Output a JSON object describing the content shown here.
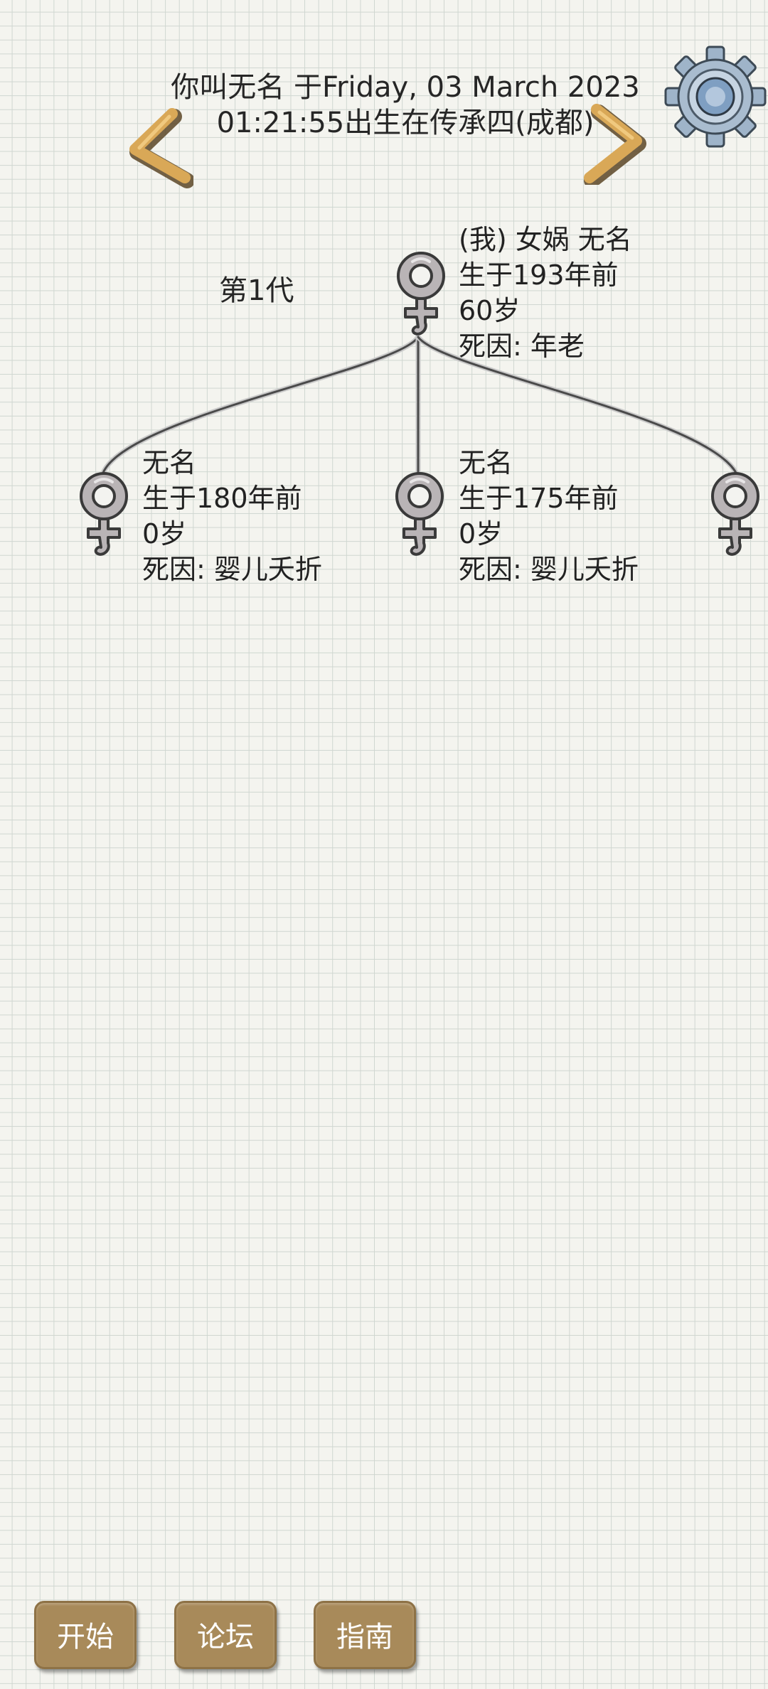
{
  "header": {
    "line1": "你叫无名 于Friday, 03 March 2023",
    "line2": "01:21:55出生在传承四(成都)"
  },
  "generation": {
    "label": "第1代"
  },
  "root_person": {
    "name_line": "(我) 女娲 无名",
    "born": "生于193年前",
    "age": "60岁",
    "death": "死因:  年老"
  },
  "children": [
    {
      "name": "无名",
      "born": "生于180年前",
      "age": "0岁",
      "death": "死因:  婴儿夭折"
    },
    {
      "name": "无名",
      "born": "生于175年前",
      "age": "0岁",
      "death": "死因:  婴儿夭折"
    }
  ],
  "buttons": {
    "start": "开始",
    "forum": "论坛",
    "guide": "指南"
  },
  "colors": {
    "button_bg": "#a88a5a",
    "arrow": "#d9a857",
    "gear": "#9fb4c9"
  }
}
